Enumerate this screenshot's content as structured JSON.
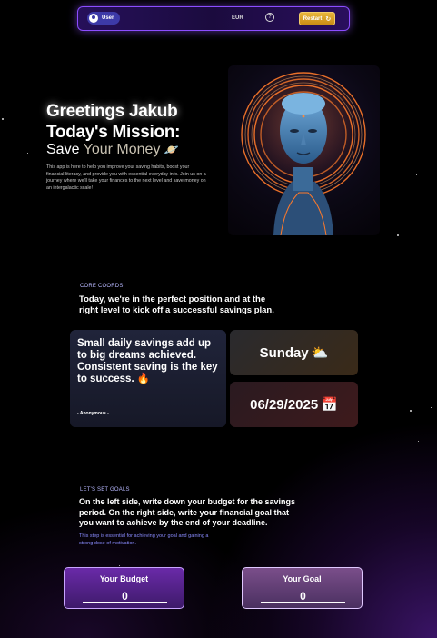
{
  "nav": {
    "user_label": "User",
    "currency": "EUR",
    "help_symbol": "?",
    "restart_label": "Restart"
  },
  "hero": {
    "greeting": "Greetings Jakub",
    "mission_label": "Today's Mission:",
    "mission_verb": "Save",
    "mission_object": "Your Money",
    "description": "This app is here to help you improve your saving habits, boost your financial literacy, and provide you with essential everyday info. Join us on a journey where we'll take your finances to the next level and save money on an intergalactic scale!"
  },
  "core": {
    "label": "CORE COORDS",
    "text": "Today, we're in the perfect position and at the right level to kick off a successful savings plan."
  },
  "quote": {
    "text": "Small daily savings add up to big dreams achieved. Consistent saving is the key to success.",
    "author": "- Anonymous -"
  },
  "day": {
    "name": "Sunday"
  },
  "date": {
    "value": "06/29/2025"
  },
  "goals": {
    "label": "LET'S SET GOALS",
    "text": "On the left side, write down your budget for the savings period. On the right side, write your financial goal that you want to achieve by the end of your deadline.",
    "note": "This step is essential for achieving your goal and gaining a strong dose of motivation.",
    "budget_label": "Your Budget",
    "budget_value": "0",
    "goal_label": "Your Goal",
    "goal_value": "0"
  },
  "colors": {
    "accent": "#8c4dff",
    "restart": "#e0a52a",
    "note": "#8a8cff"
  },
  "icons": {
    "user": "user-icon",
    "help": "help-circle-icon",
    "restart": "restart-icon",
    "planet": "planet-icon",
    "flame": "flame-icon",
    "weather": "sun-cloud-icon",
    "calendar": "calendar-icon"
  }
}
